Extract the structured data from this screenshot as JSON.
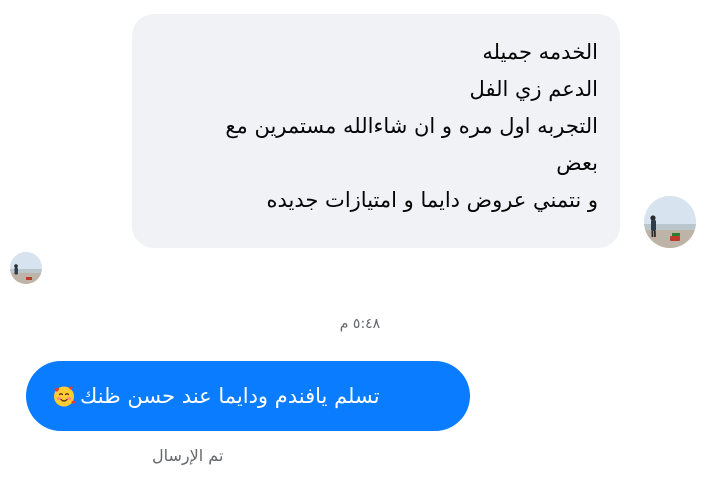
{
  "thread": {
    "incoming": {
      "lines": [
        "الخدمه جميله",
        "الدعم زي الفل",
        "التجربه اول مره و ان شاءالله مستمرين مع",
        "بعض",
        "و نتمني عروض دايما و امتيازات جديده"
      ],
      "avatar_icon": "user-avatar-beach-photo"
    },
    "timestamp": "٥:٤٨ م",
    "outgoing": {
      "text": "تسلم يافندم ودايما عند حسن ظنك",
      "emoji_icon": "smiling-face-with-hearts-icon"
    },
    "status": "تم الإرسال",
    "colors": {
      "incoming_bubble": "#f0f2f5",
      "outgoing_bubble": "#0a7cff",
      "meta_text": "#65676b"
    }
  }
}
